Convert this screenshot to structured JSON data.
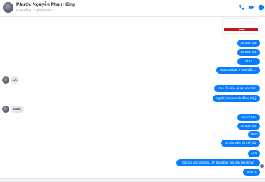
{
  "header": {
    "name": "Phước Nguyễn Phan Hồng",
    "status": "Hoạt động 11 phút trước",
    "icons": [
      "phone-icon",
      "video-icon",
      "info-icon"
    ]
  },
  "colors": {
    "accent": "#0a7cff",
    "incoming": "#e4e6eb"
  },
  "messages": [
    {
      "side": "out",
      "text": "35 506 636"
    },
    {
      "side": "out",
      "text": "36 506 636"
    },
    {
      "side": "out",
      "text": "3144"
    },
    {
      "side": "out",
      "text": "mau cái bác e bao việc..."
    },
    {
      "side": "in",
      "text": "Ok"
    },
    {
      "side": "out",
      "text": "đau rồi mau giuso em bác"
    },
    {
      "side": "out",
      "text": "người anh em ck đâuu rồi ý"
    },
    {
      "side": "in",
      "text": "Đayb"
    },
    {
      "side": "out",
      "text": "vào đi bác"
    },
    {
      "side": "out",
      "text": "36 506 636"
    },
    {
      "side": "out",
      "text": "7540"
    },
    {
      "side": "out",
      "text": "cn vào việc kh thể bác"
    },
    {
      "side": "out",
      "text": "ALO"
    },
    {
      "side": "out",
      "text": "bác có vào việc kh.. kh thì inbox em làm bên khác"
    },
    {
      "side": "out",
      "text": "scam à"
    }
  ]
}
